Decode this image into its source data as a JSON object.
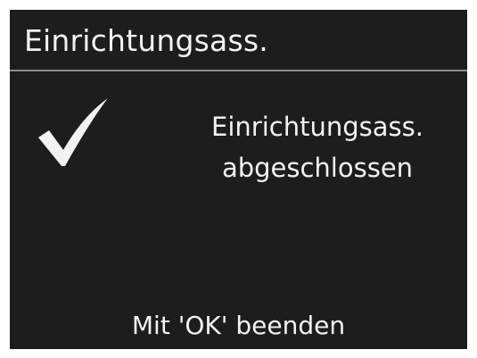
{
  "header": {
    "title": "Einrichtungsass."
  },
  "message": {
    "line1": "Einrichtungsass.",
    "line2": "abgeschlossen"
  },
  "footer": {
    "hint": "Mit 'OK' beenden"
  },
  "icons": {
    "status": "checkmark-icon"
  },
  "colors": {
    "screen_background": "#1d1d1d",
    "text": "#f2f2f2",
    "divider": "#8c8c8c"
  }
}
